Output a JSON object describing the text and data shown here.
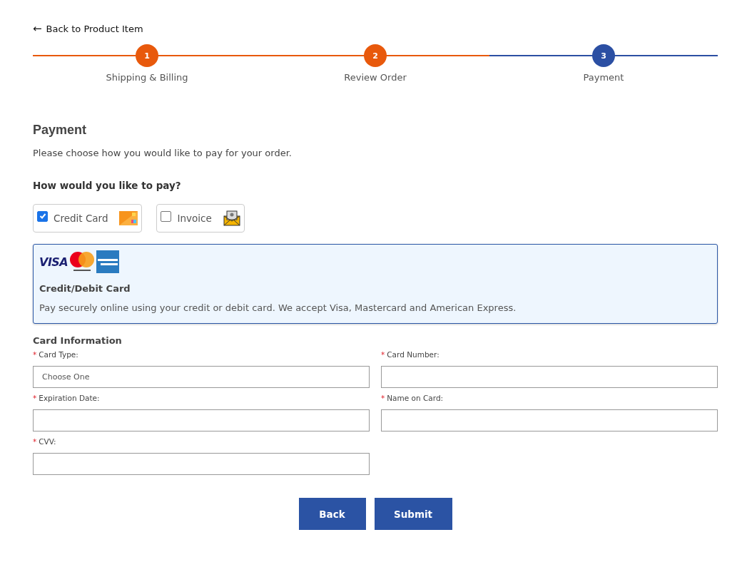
{
  "back_link": {
    "arrow": "←",
    "label": "Back to Product Item"
  },
  "steps": [
    {
      "number": "1",
      "label": "Shipping & Billing",
      "completed": true
    },
    {
      "number": "2",
      "label": "Review Order",
      "completed": true
    },
    {
      "number": "3",
      "label": "Payment",
      "completed": false
    }
  ],
  "heading": "Payment",
  "intro": "Please choose how you would like to pay for your order.",
  "pay_question": "How would you like to pay?",
  "pay_options": [
    {
      "label": "Credit Card",
      "kind": "card",
      "checked": true
    },
    {
      "label": "Invoice",
      "kind": "invoice",
      "checked": false
    }
  ],
  "card_panel": {
    "logos": [
      {
        "kind": "visa",
        "label": "VISA"
      },
      {
        "kind": "mastercard"
      },
      {
        "kind": "amex"
      }
    ],
    "title": "Credit/Debit Card",
    "text": "Pay securely online using your credit or debit card. We accept Visa, Mastercard and American Express."
  },
  "card_info": {
    "title": "Card Information",
    "fields": [
      {
        "label": "Card Type:",
        "required_mark": "*",
        "placeholder": "Choose One"
      },
      {
        "label": "Card Number:",
        "required_mark": "*"
      },
      {
        "label": "Expiration Date:",
        "required_mark": "*"
      },
      {
        "label": "Name on Card:",
        "required_mark": "*"
      },
      {
        "label": "CVV:",
        "required_mark": "*"
      }
    ]
  },
  "buttons": [
    "Back",
    "Submit"
  ]
}
